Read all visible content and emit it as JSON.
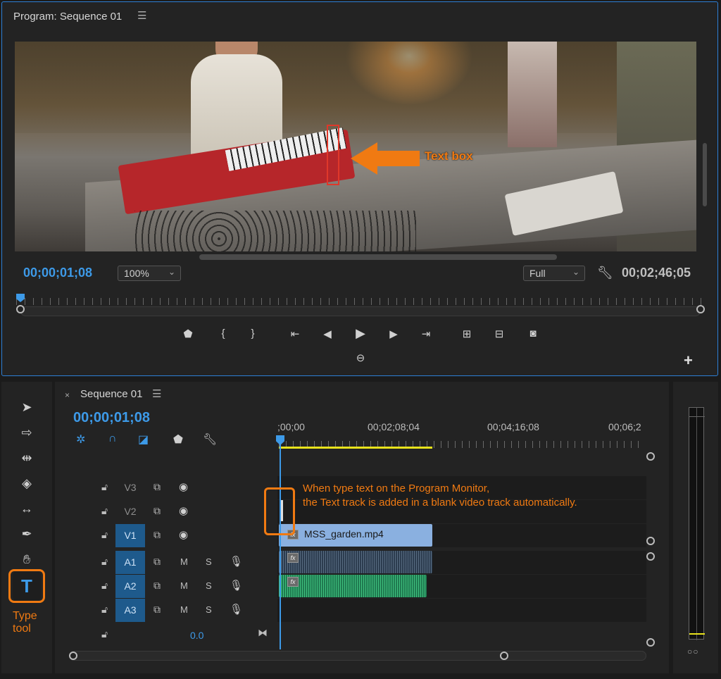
{
  "program_monitor": {
    "title": "Program: Sequence 01",
    "menu_icon": "hamburger-icon",
    "timecode_current": "00;00;01;08",
    "zoom": "100%",
    "resolution": "Full",
    "timecode_duration": "00;02;46;05",
    "annotation_text_box": "Text box",
    "accent_color": "#3d9ae8",
    "annotation_color": "#f07a12"
  },
  "timeline": {
    "title": "Sequence 01",
    "timecode": "00;00;01;08",
    "ruler_labels": [
      ";00;00",
      "00;02;08;04",
      "00;04;16;08",
      "00;06;2"
    ],
    "tracks": [
      {
        "name": "V3",
        "type": "video",
        "active": false
      },
      {
        "name": "V2",
        "type": "video",
        "active": false
      },
      {
        "name": "V1",
        "type": "video",
        "active": true
      },
      {
        "name": "A1",
        "type": "audio",
        "active": true
      },
      {
        "name": "A2",
        "type": "audio",
        "active": true
      },
      {
        "name": "A3",
        "type": "audio",
        "active": true
      }
    ],
    "mute_label": "M",
    "solo_label": "S",
    "master_value": "0.0",
    "clip_v1_name": "MSS_garden.mp4",
    "fx_label": "fx",
    "annotation_line1": "When type text on the Program Monitor,",
    "annotation_line2": "the Text track is added in a blank video track automatically."
  },
  "tools": {
    "type_tool_annotation": "Type tool",
    "type_tool_glyph": "T"
  },
  "meters": {
    "solo_buttons": "○○"
  }
}
